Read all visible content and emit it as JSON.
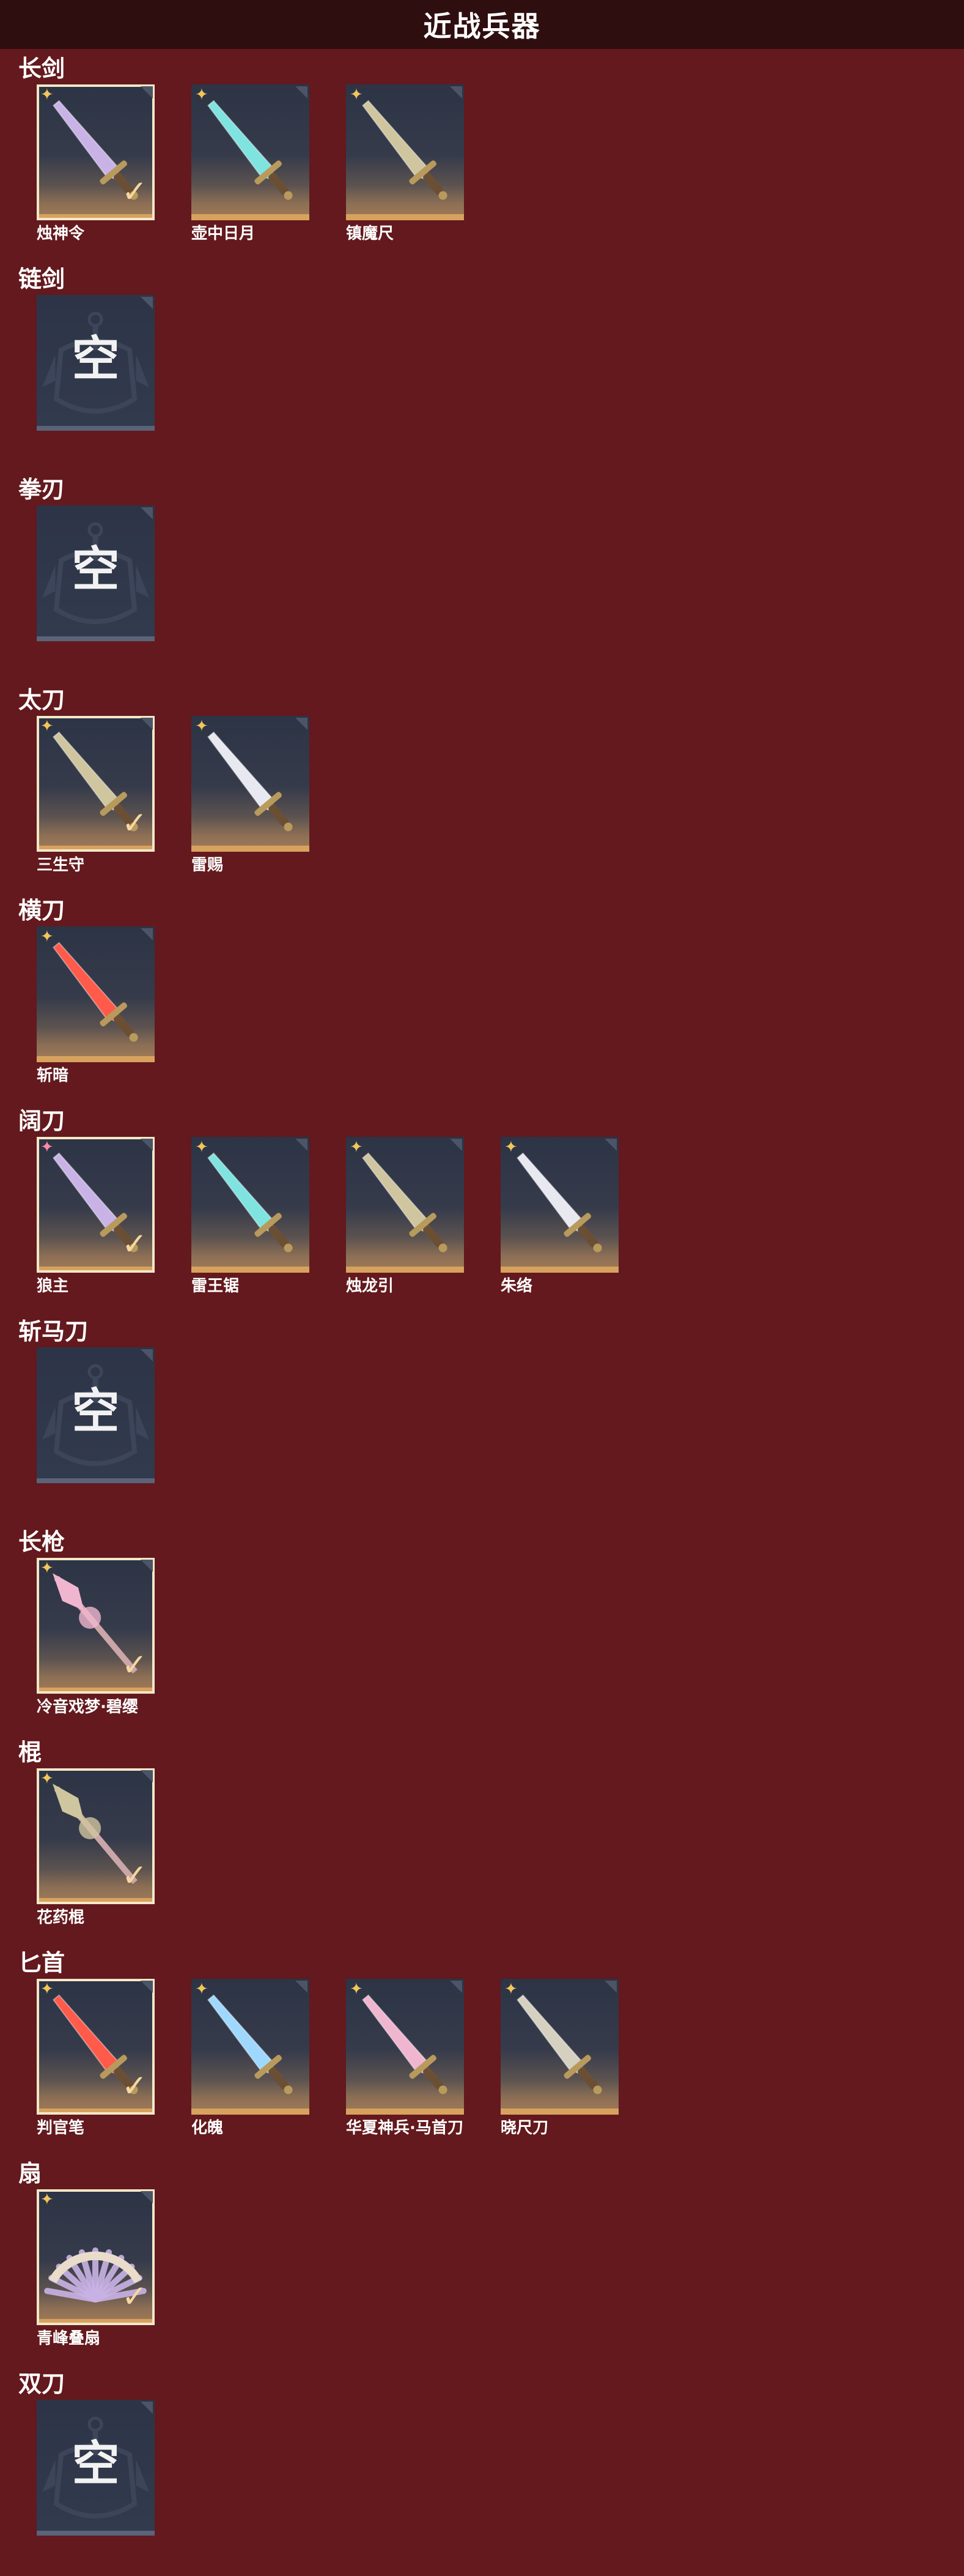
{
  "page_title": "近战兵器",
  "empty_label": "空",
  "colors": {
    "background": "#63191d",
    "header": "#2f0e10",
    "accent": "#d7a25e"
  },
  "categories": [
    {
      "title": "长剑",
      "items": [
        {
          "name": "烛神令",
          "rarity": "gold-star",
          "equipped": true,
          "icon": "sword-icon"
        },
        {
          "name": "壶中日月",
          "rarity": "gold-star",
          "equipped": false,
          "icon": "sword-icon"
        },
        {
          "name": "镇魔尺",
          "rarity": "gold-star",
          "equipped": false,
          "icon": "sword-icon"
        }
      ]
    },
    {
      "title": "链剑",
      "items": []
    },
    {
      "title": "拳刃",
      "items": []
    },
    {
      "title": "太刀",
      "items": [
        {
          "name": "三生守",
          "rarity": "gold-star",
          "equipped": true,
          "icon": "katana-icon"
        },
        {
          "name": "雷赐",
          "rarity": "gold-star",
          "equipped": false,
          "icon": "katana-icon"
        }
      ]
    },
    {
      "title": "横刀",
      "items": [
        {
          "name": "斩暗",
          "rarity": "gold-star",
          "equipped": false,
          "icon": "saber-icon"
        }
      ]
    },
    {
      "title": "阔刀",
      "items": [
        {
          "name": "狼主",
          "rarity": "red-star",
          "equipped": true,
          "icon": "greatsword-icon"
        },
        {
          "name": "雷王锯",
          "rarity": "gold-star",
          "equipped": false,
          "icon": "greatsword-icon"
        },
        {
          "name": "烛龙引",
          "rarity": "gold-star",
          "equipped": false,
          "icon": "greatsword-icon"
        },
        {
          "name": "朱络",
          "rarity": "gold-star",
          "equipped": false,
          "icon": "greatsword-icon"
        }
      ]
    },
    {
      "title": "斩马刀",
      "items": []
    },
    {
      "title": "长枪",
      "items": [
        {
          "name": "冷音戏梦·碧缨",
          "rarity": "gold-star",
          "equipped": true,
          "icon": "spear-icon"
        }
      ]
    },
    {
      "title": "棍",
      "items": [
        {
          "name": "花药棍",
          "rarity": "gold-star",
          "equipped": true,
          "icon": "staff-icon"
        }
      ]
    },
    {
      "title": "匕首",
      "items": [
        {
          "name": "判官笔",
          "rarity": "gold-star",
          "equipped": true,
          "icon": "dagger-icon"
        },
        {
          "name": "化魄",
          "rarity": "gold-star",
          "equipped": false,
          "icon": "dagger-icon"
        },
        {
          "name": "华夏神兵·马首刀",
          "rarity": "gold-star",
          "equipped": false,
          "icon": "dagger-icon"
        },
        {
          "name": "晓尺刀",
          "rarity": "gold-star",
          "equipped": false,
          "icon": "dagger-icon"
        }
      ]
    },
    {
      "title": "扇",
      "items": [
        {
          "name": "青峰叠扇",
          "rarity": "gold-star",
          "equipped": true,
          "icon": "fan-icon"
        }
      ]
    },
    {
      "title": "双刀",
      "items": []
    }
  ]
}
